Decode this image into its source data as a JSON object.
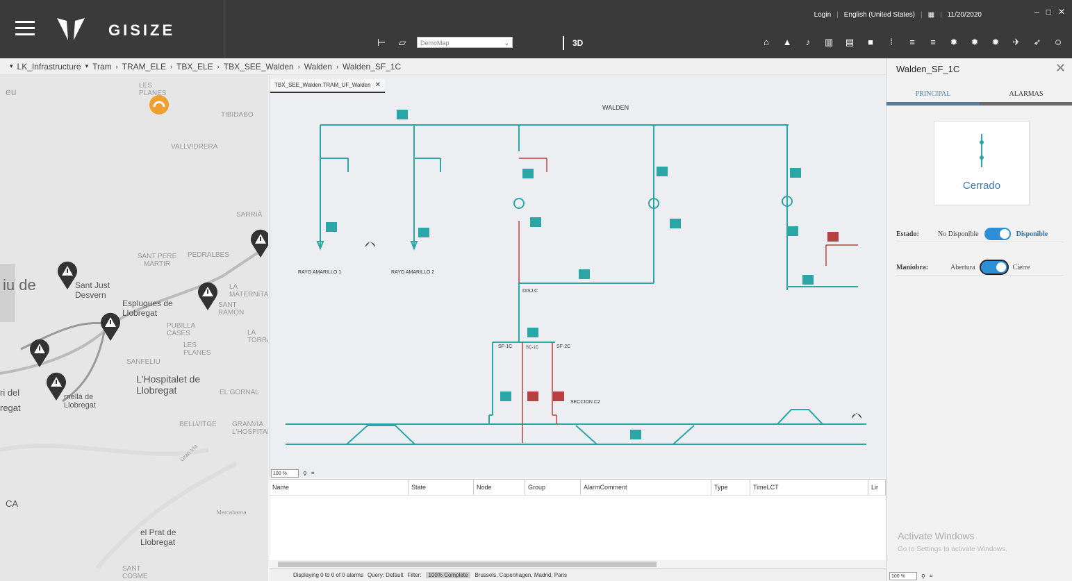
{
  "app": {
    "name": "GISIZE"
  },
  "header": {
    "login": "Login",
    "language": "English (United States)",
    "date": "11/20/2020",
    "map_selector": "DemoMap",
    "btn_3d": "3D"
  },
  "breadcrumb": [
    "LK_Infrastructure",
    "Tram",
    "TRAM_ELE",
    "TBX_ELE",
    "TBX_SEE_Walden",
    "Walden",
    "Walden_SF_1C"
  ],
  "map": {
    "labels": [
      "eu",
      "LES PLANES",
      "TIBIDABO",
      "VALLVIDRERA",
      "SARRIÀ",
      "SANT PERE MÀRTIR",
      "PEDRALBES",
      "LA MATERNITAT",
      "iu de",
      "Sant Just Desvern",
      "Esplugues de Llobregat",
      "SANT RAMON",
      "PUBILLA CASES",
      "LA TORRASSA",
      "LES PLANES",
      "SANFELIU",
      "L'Hospitalet de Llobregat",
      "EL GORNAL",
      "BELLVITGE",
      "GRANVIA L'HOSPITALET",
      "ri del",
      "regat",
      "rnellà de Llobregat",
      "el Prat de Llobregat",
      "Mercabarna",
      "Gran Via",
      "CA",
      "SANT COSME"
    ]
  },
  "diagram": {
    "tab": "TBX_SEE_Walden.TRAM_UF_Walden",
    "title": "WALDEN",
    "labels": [
      "RAYO AMARILLO 1",
      "RAYO AMARILLO 2",
      "DISJ.C",
      "SF-1C",
      "SC-1C",
      "SF-2C",
      "SECCION C2"
    ],
    "zoom": "100 %"
  },
  "alarms": {
    "columns": [
      "Name",
      "State",
      "Node",
      "Group",
      "AlarmComment",
      "Type",
      "TimeLCT",
      "Lir"
    ],
    "status": "Displaying 0 to 0 of 0 alarms",
    "query": "Query: Default",
    "filter": "Filter:",
    "progress": "100% Complete",
    "timezone": "Brussels, Copenhagen, Madrid, Paris"
  },
  "panel": {
    "title": "Walden_SF_1C",
    "tabs": [
      "PRINCIPAL",
      "ALARMAS"
    ],
    "state_text": "Cerrado",
    "estado": {
      "label": "Estado:",
      "off": "No Disponible",
      "on": "Disponible"
    },
    "maniobra": {
      "label": "Maniobra:",
      "off": "Abertura",
      "on": "Cierre"
    },
    "activate_title": "Activate Windows",
    "activate_sub": "Go to Settings to activate Windows.",
    "zoom": "100 %"
  },
  "colors": {
    "topbar": "#3a3a3a",
    "line": "#2aa6a6",
    "red": "#b84040",
    "toggle": "#2c8fd6"
  }
}
